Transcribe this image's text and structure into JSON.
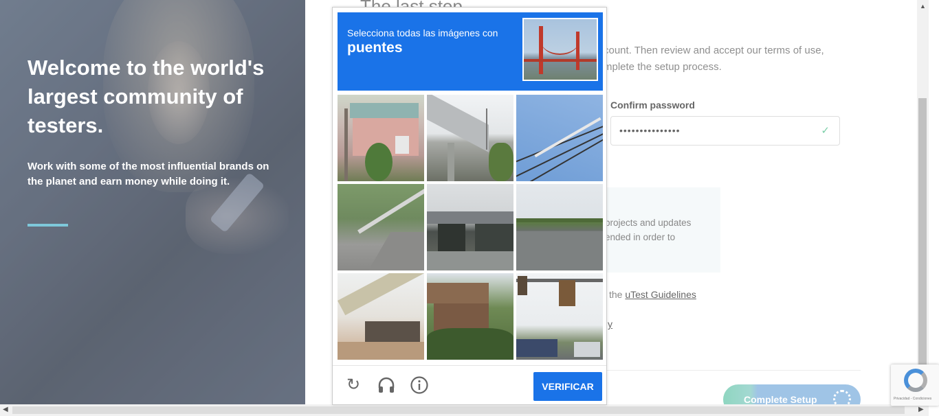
{
  "hero": {
    "title": "Welcome to the world's largest community of testers.",
    "subtitle": "Work with some of the most influential brands on the planet and earn money while doing it."
  },
  "form": {
    "step_title": "The last step",
    "intro_line1": "count. Then review and accept our terms of use,",
    "intro_line2": "mplete the setup process.",
    "confirm_password_label": "Confirm password",
    "confirm_password_value": "•••••••••••••••",
    "info_text": "projects and updates ended in order to",
    "guidelines_prefix": "the ",
    "guidelines_link": "uTest Guidelines",
    "privacy_fragment": "y",
    "complete_button": "Complete Setup"
  },
  "captcha": {
    "instruction": "Selecciona todas las imágenes con",
    "target": "puentes",
    "verify_button": "VERIFICAR",
    "tiles": [
      "house",
      "bridge-underside",
      "power-lines",
      "guardrail-road",
      "overpass",
      "highway",
      "concrete-bridge",
      "tropical-house",
      "traffic-light"
    ]
  },
  "recaptcha_badge": {
    "terms": "Privacidad - Condiciones"
  }
}
